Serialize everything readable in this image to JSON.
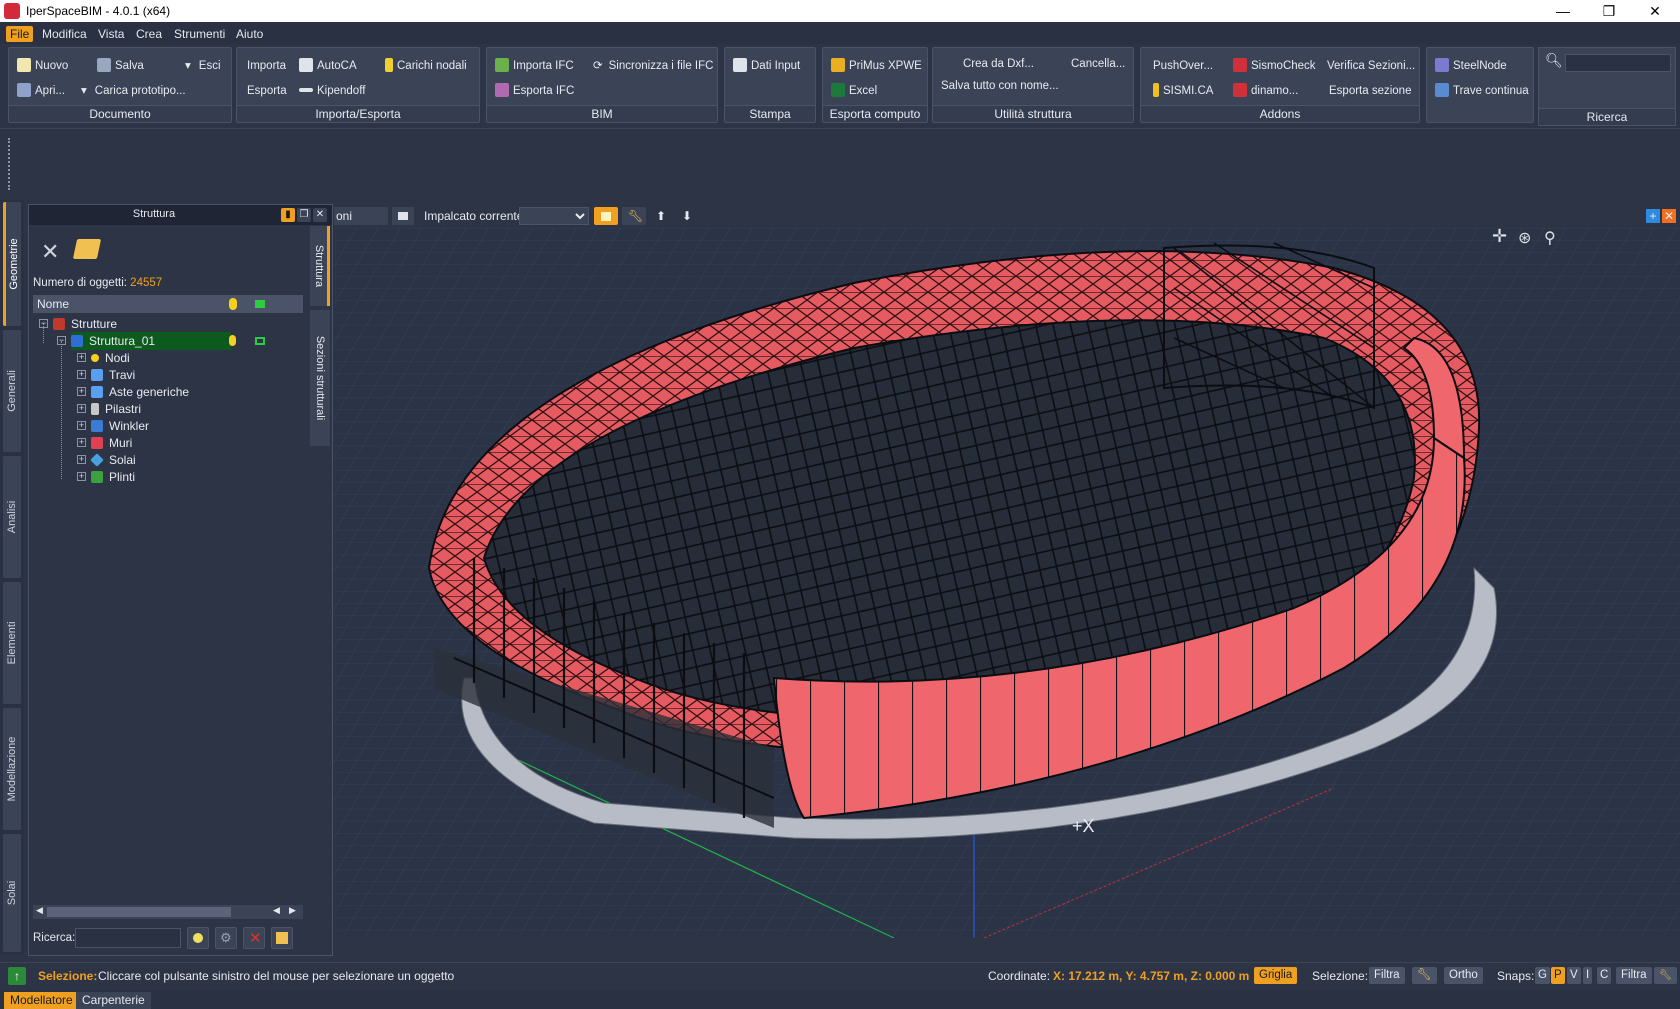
{
  "window": {
    "title": "IperSpaceBIM - 4.0.1 (x64)",
    "min": "—",
    "max": "❐",
    "close": "✕"
  },
  "menu": [
    "File",
    "Modifica",
    "Vista",
    "Crea",
    "Strumenti",
    "Aiuto"
  ],
  "ribbon": {
    "documento": {
      "label": "Documento",
      "nuovo": "Nuovo",
      "salva": "Salva",
      "esci": "Esci",
      "apri": "Apri...",
      "carica": "Carica prototipo..."
    },
    "importa": {
      "label": "Importa/Esporta",
      "importa": "Importa",
      "autoca": "AutoCA",
      "carichi": "Carichi nodali",
      "esporta": "Esporta",
      "kipendoff": "Kipendoff"
    },
    "bim": {
      "label": "BIM",
      "importa_ifc": "Importa IFC",
      "sincronizza": "Sincronizza i file IFC",
      "esporta_ifc": "Esporta IFC"
    },
    "stampa": {
      "label": "Stampa",
      "dati": "Dati Input"
    },
    "computo": {
      "label": "Esporta computo",
      "primus": "PriMus XPWE",
      "excel": "Excel"
    },
    "utilita": {
      "label": "Utilità struttura",
      "crea_dxf": "Crea da Dxf...",
      "cancella": "Cancella...",
      "salva_tutto": "Salva tutto con nome..."
    },
    "addons": {
      "label": "Addons",
      "pushover": "PushOver...",
      "sismocheck": "SismoCheck",
      "verifica": "Verifica Sezioni...",
      "sismica": "SISMI.CA",
      "dinamo": "dinamo...",
      "esporta_sezione": "Esporta sezione"
    },
    "steel": {
      "steelnode": "SteelNode",
      "trave": "Trave continua"
    },
    "ricerca": {
      "label": "Ricerca"
    }
  },
  "vtabs": [
    "Geometrie",
    "Generali",
    "Analisi",
    "Elementi",
    "Modellazione",
    "Solai"
  ],
  "panel": {
    "title": "Struttura",
    "count_label": "Numero di oggetti:",
    "count": "24557",
    "col_name": "Nome",
    "search_label": "Ricerca:",
    "tree": [
      {
        "label": "Strutture",
        "level": 0,
        "color": "#c0392b"
      },
      {
        "label": "Struttura_01",
        "level": 1,
        "color": "#2e6fd6",
        "selected": true
      },
      {
        "label": "Nodi",
        "level": 2,
        "color": "#f5d020"
      },
      {
        "label": "Travi",
        "level": 2,
        "color": "#5aa0f0"
      },
      {
        "label": "Aste generiche",
        "level": 2,
        "color": "#5aa0f0"
      },
      {
        "label": "Pilastri",
        "level": 2,
        "color": "#c8c8c8"
      },
      {
        "label": "Winkler",
        "level": 2,
        "color": "#3a7bd5"
      },
      {
        "label": "Muri",
        "level": 2,
        "color": "#e04050"
      },
      {
        "label": "Solai",
        "level": 2,
        "color": "#4aa0e0"
      },
      {
        "label": "Plinti",
        "level": 2,
        "color": "#3aa040"
      }
    ],
    "side_tabs": [
      "Struttura",
      "Sezioni strutturali"
    ]
  },
  "viewbar": {
    "tab": "oni vista...",
    "floor_label": "Impalcato corrente:"
  },
  "viewport": {
    "axis_label": "+X"
  },
  "status": {
    "sel_label": "Selezione:",
    "sel_text": "Cliccare col pulsante sinistro del mouse per selezionare un oggetto",
    "coord_label": "Coordinate:",
    "coord_value": "X: 17.212 m, Y: 4.757 m, Z: 0.000 m",
    "griglia": "Griglia",
    "selezione": "Selezione:",
    "filtra": "Filtra",
    "ortho": "Ortho",
    "snaps": "Snaps:",
    "snap_keys": [
      "G",
      "P",
      "V",
      "I",
      "C"
    ],
    "filtra2": "Filtra"
  },
  "bottom_tabs": [
    "Modellatore",
    "Carpenterie"
  ]
}
